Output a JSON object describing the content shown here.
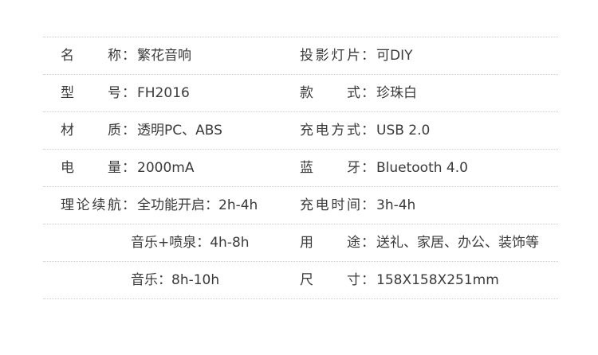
{
  "specs": {
    "rows": [
      {
        "left": {
          "label": "名称",
          "value": "繁花音响"
        },
        "right": {
          "label": "投影灯片",
          "value": "可DIY"
        }
      },
      {
        "left": {
          "label": "型号",
          "value": "FH2016"
        },
        "right": {
          "label": "款式",
          "value": "珍珠白"
        }
      },
      {
        "left": {
          "label": "材质",
          "value": "透明PC、ABS"
        },
        "right": {
          "label": "充电方式",
          "value": "USB 2.0"
        }
      },
      {
        "left": {
          "label": "电量",
          "value": "2000mA"
        },
        "right": {
          "label": "蓝牙",
          "value": "Bluetooth 4.0"
        }
      },
      {
        "left": {
          "label": "理论续航",
          "value": "全功能开启：2h-4h"
        },
        "right": {
          "label": "充电时间",
          "value": "3h-4h"
        }
      },
      {
        "left": {
          "value": "音乐+喷泉：4h-8h"
        },
        "right": {
          "label": "用途",
          "value": "送礼、家居、办公、装饰等"
        }
      },
      {
        "left": {
          "value": "音乐：8h-10h"
        },
        "right": {
          "label": "尺寸",
          "value": "158X158X251mm"
        }
      }
    ],
    "separator": "："
  }
}
